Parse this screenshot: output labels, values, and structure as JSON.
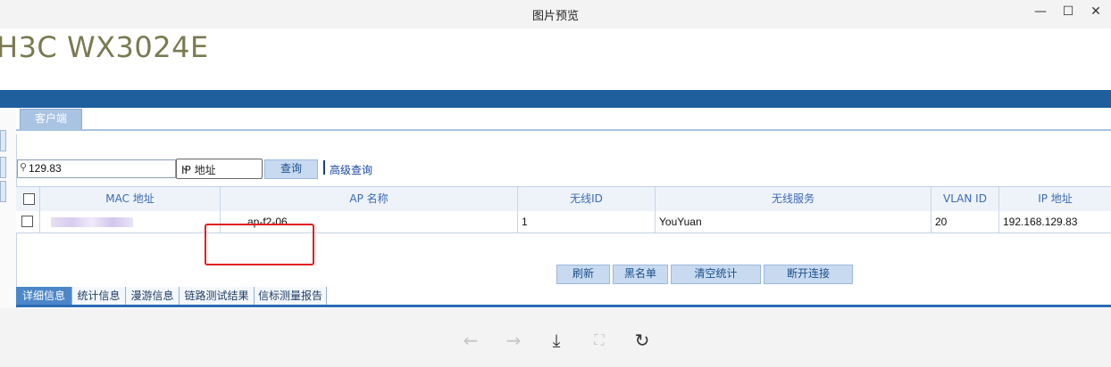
{
  "window": {
    "title": "图片预览",
    "controls": {
      "minimize": "—",
      "maximize": "☐",
      "close": "✕"
    }
  },
  "app": {
    "brand": "H3C WX3024E"
  },
  "tabs": {
    "client": "客户端"
  },
  "search": {
    "value": "129.83",
    "field_select": "IP 地址",
    "query_button": "查询",
    "advanced_link": "高级查询"
  },
  "table": {
    "columns": [
      "MAC 地址",
      "AP 名称",
      "无线ID",
      "无线服务",
      "VLAN ID",
      "IP 地址"
    ],
    "rows": [
      {
        "mac": "",
        "ap_name": "ap-f2-06",
        "wireless_id": "1",
        "service": "YouYuan",
        "vlan": "20",
        "ip": "192.168.129.83"
      }
    ]
  },
  "actions": {
    "refresh": "刷新",
    "blacklist": "黑名单",
    "clear_stats": "清空统计",
    "disconnect": "断开连接"
  },
  "bottom_tabs": [
    "详细信息",
    "统计信息",
    "漫游信息",
    "链路测试结果",
    "信标测量报告"
  ],
  "viewer_toolbar": {
    "prev_icon": "←",
    "next_icon": "→",
    "download_icon": "⤓",
    "fit_icon": "⛶",
    "rotate_icon": "↻"
  },
  "colors": {
    "accent_blue": "#1f5f9e",
    "highlight_red": "#e02020",
    "header_text": "#3d6ab3"
  }
}
